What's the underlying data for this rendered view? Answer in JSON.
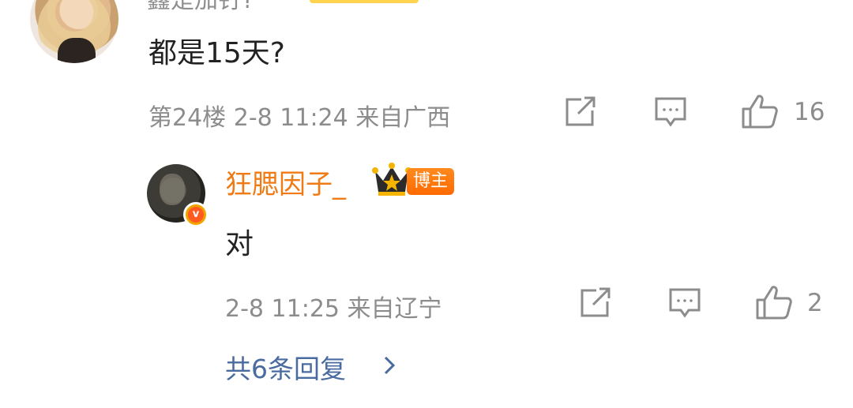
{
  "comment": {
    "author_name": "鑫是加钉?",
    "text": "都是15天?",
    "floor": "第24楼",
    "time": "2-8 11:24",
    "location": "来自广西",
    "like_count": "16"
  },
  "reply": {
    "author_name": "狂腮因子_",
    "badge": "博主",
    "verified_mark": "v",
    "text": "对",
    "time": "2-8 11:25",
    "location": "来自辽宁",
    "like_count": "2"
  },
  "more_replies_label": "共6条回复",
  "colors": {
    "author_orange": "#f07a14",
    "badge_orange": "#ff7a0f",
    "link_blue": "#4a6ba0",
    "meta_gray": "#8c8c8c",
    "text_dark": "#222222"
  },
  "icons": [
    "repost-icon",
    "comment-icon",
    "like-icon",
    "crown-icon",
    "chevron-right-icon"
  ]
}
